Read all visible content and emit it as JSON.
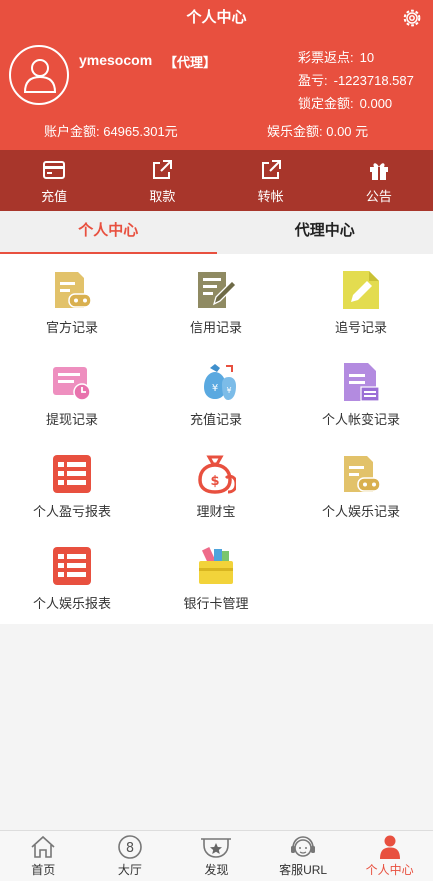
{
  "header": {
    "title": "个人中心",
    "settings_icon": "gear-icon"
  },
  "profile": {
    "username": "ymesocom",
    "role": "【代理】",
    "rebate_label": "彩票返点:",
    "rebate_value": "10",
    "profit_label": "盈亏:",
    "profit_value": "-1223718.587",
    "locked_label": "锁定金额:",
    "locked_value": "0.000",
    "account_balance": "账户金额: 64965.301元",
    "entertainment_balance": "娱乐金额: 0.00 元"
  },
  "actions": [
    {
      "label": "充值",
      "icon": "card-icon"
    },
    {
      "label": "取款",
      "icon": "external-link-icon"
    },
    {
      "label": "转帐",
      "icon": "external-link-icon"
    },
    {
      "label": "公告",
      "icon": "gift-icon"
    }
  ],
  "tabs": [
    {
      "label": "个人中心",
      "active": true
    },
    {
      "label": "代理中心",
      "active": false
    }
  ],
  "menu": [
    {
      "label": "官方记录",
      "icon": "document-game-icon",
      "color": "#e2c26a"
    },
    {
      "label": "信用记录",
      "icon": "document-pen-icon",
      "color": "#8f8a62"
    },
    {
      "label": "追号记录",
      "icon": "document-pencil-icon",
      "color": "#e3dc4f"
    },
    {
      "label": "提现记录",
      "icon": "withdraw-clock-icon",
      "color": "#ee8fbf"
    },
    {
      "label": "充值记录",
      "icon": "money-bags-icon",
      "color": "#5aa9e0"
    },
    {
      "label": "个人帐变记录",
      "icon": "document-list-icon",
      "color": "#b38be0"
    },
    {
      "label": "个人盈亏报表",
      "icon": "list-report-icon",
      "color": "#e8503f"
    },
    {
      "label": "理财宝",
      "icon": "money-bag-icon",
      "color": "#e8503f"
    },
    {
      "label": "个人娱乐记录",
      "icon": "document-game-icon",
      "color": "#e2c26a"
    },
    {
      "label": "个人娱乐报表",
      "icon": "list-report-icon",
      "color": "#e8503f"
    },
    {
      "label": "银行卡管理",
      "icon": "wallet-icon",
      "color": "#f2d33a"
    }
  ],
  "bottom_nav": [
    {
      "label": "首页",
      "icon": "home-icon",
      "active": false
    },
    {
      "label": "大厅",
      "icon": "number-8-icon",
      "active": false
    },
    {
      "label": "发现",
      "icon": "badge-star-icon",
      "active": false
    },
    {
      "label": "客服URL",
      "icon": "headset-icon",
      "active": false
    },
    {
      "label": "个人中心",
      "icon": "person-icon",
      "active": true
    }
  ]
}
